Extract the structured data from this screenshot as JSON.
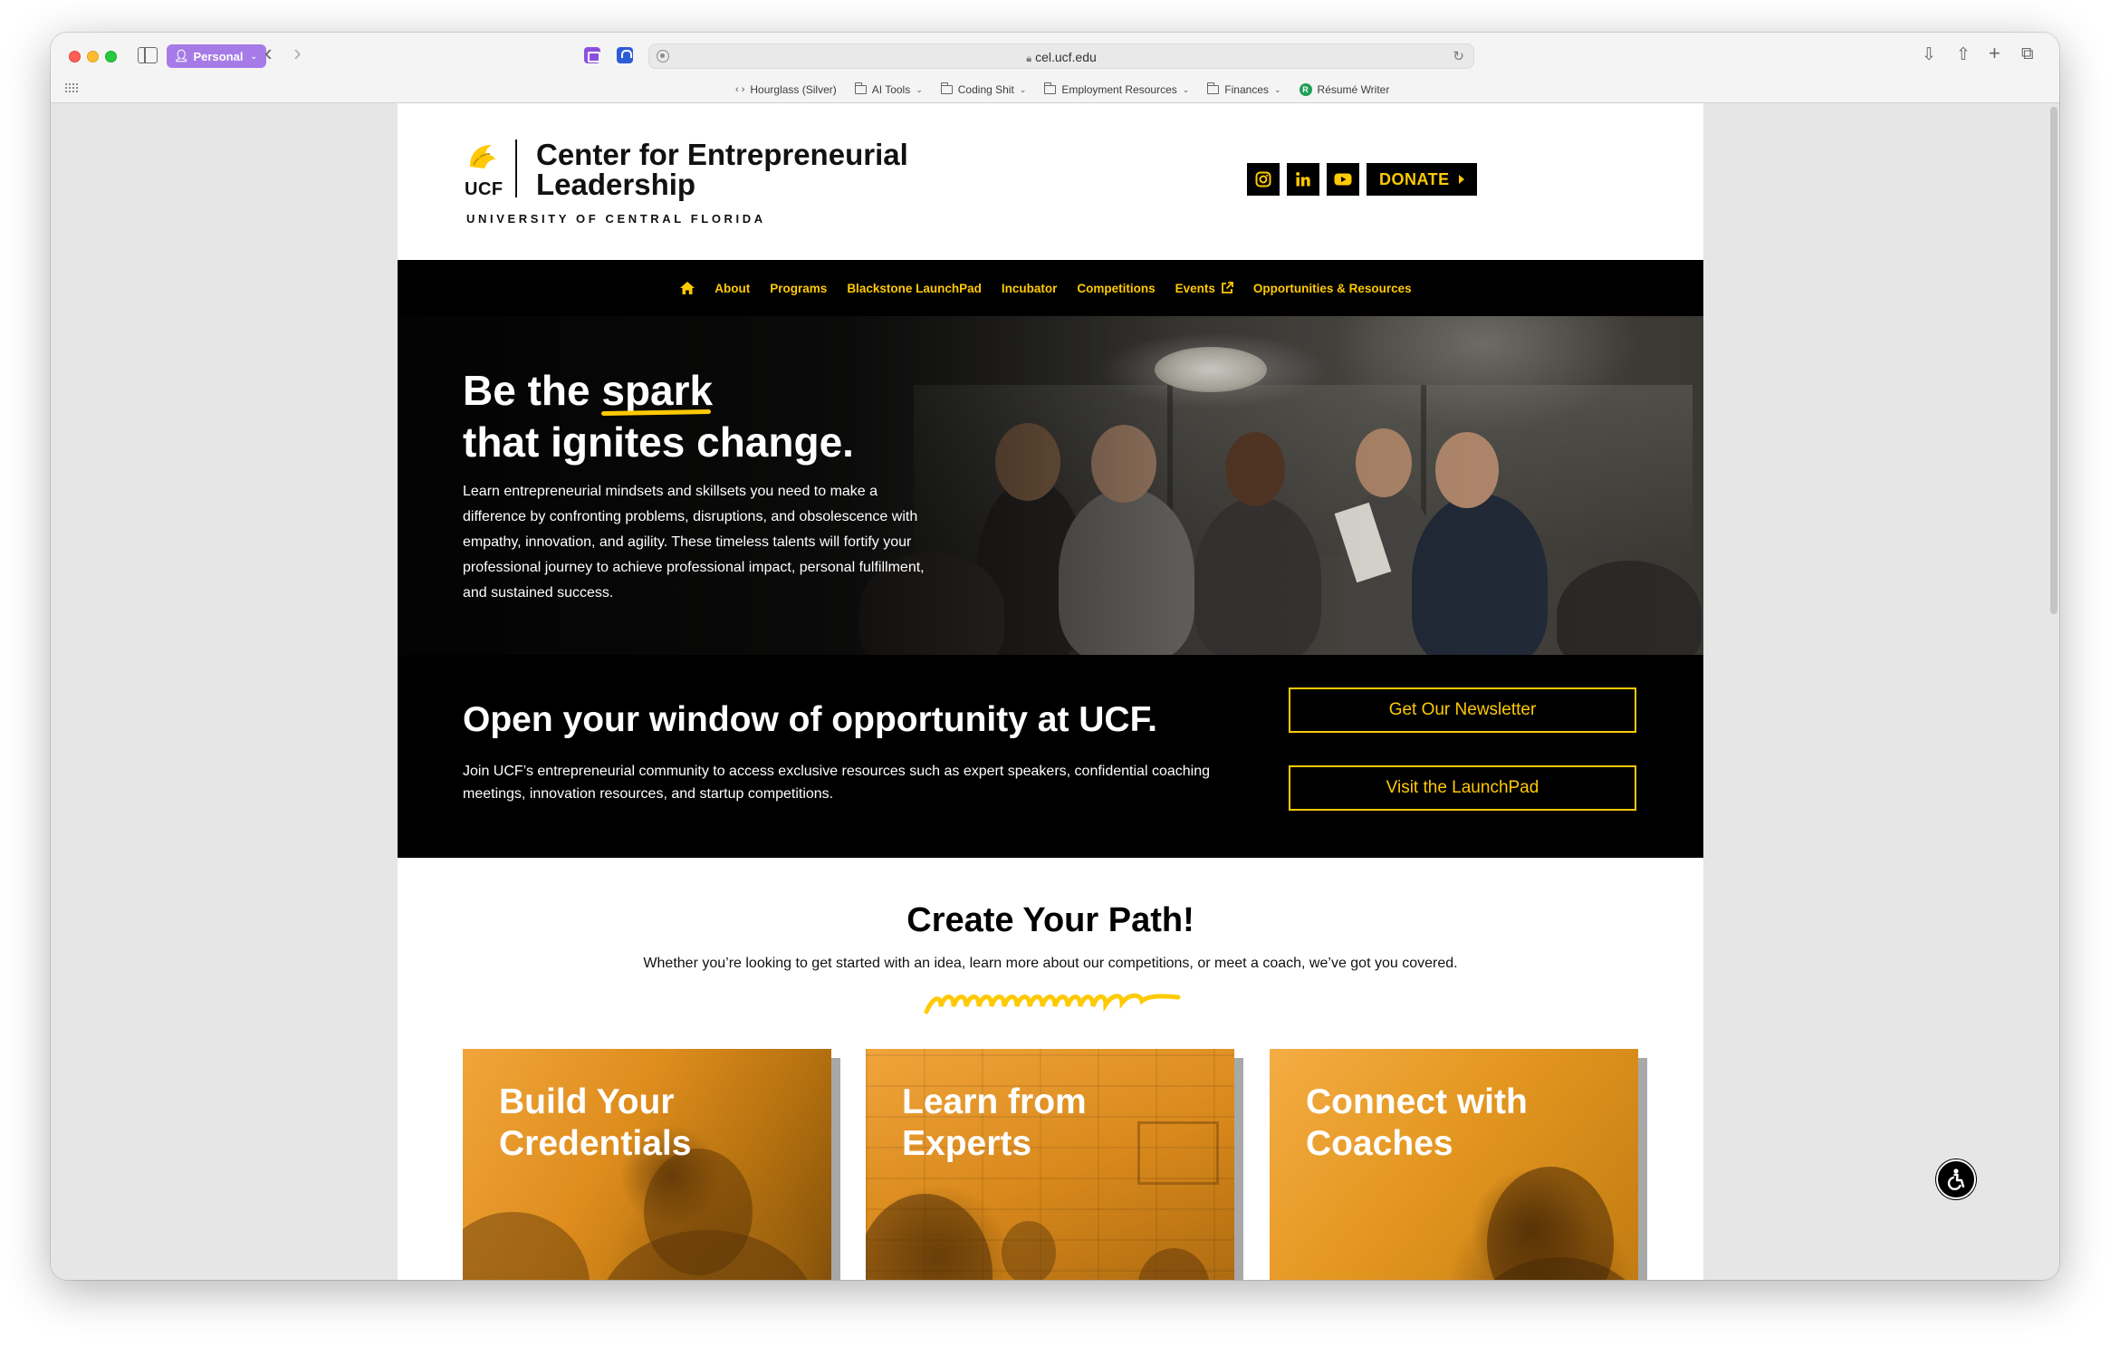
{
  "browser": {
    "profile": "Personal",
    "url": "cel.ucf.edu",
    "bookmarks": [
      {
        "label": "Hourglass (Silver)",
        "icon": "code-icon",
        "menu": false
      },
      {
        "label": "AI Tools",
        "icon": "folder-icon",
        "menu": true
      },
      {
        "label": "Coding Shit",
        "icon": "folder-icon",
        "menu": true
      },
      {
        "label": "Employment Resources",
        "icon": "folder-icon",
        "menu": true
      },
      {
        "label": "Finances",
        "icon": "folder-icon",
        "menu": true
      },
      {
        "label": "Résumé Writer",
        "icon": "resume-writer-icon",
        "menu": false
      }
    ]
  },
  "header": {
    "logo_mark": "UCF",
    "title_line1": "Center for Entrepreneurial",
    "title_line2": "Leadership",
    "subtitle": "UNIVERSITY OF CENTRAL FLORIDA",
    "donate": "DONATE",
    "social": [
      "instagram-icon",
      "linkedin-icon",
      "youtube-icon"
    ]
  },
  "nav": {
    "items": [
      "About",
      "Programs",
      "Blackstone LaunchPad",
      "Incubator",
      "Competitions",
      "Events",
      "Opportunities & Resources"
    ]
  },
  "hero": {
    "title_pre": "Be the ",
    "title_highlight": "spark",
    "title_line2": "that ignites change.",
    "body": "Learn entrepreneurial mindsets and skillsets you need to make a difference by confronting problems, disruptions, and obsolescence with empathy, innovation, and agility. These timeless talents will fortify your professional journey to achieve professional impact, personal fulfillment, and sustained success."
  },
  "cta": {
    "title": "Open your window of opportunity at UCF.",
    "body": "Join UCF’s entrepreneurial community to access exclusive resources such as expert speakers, confidential coaching meetings, innovation resources, and startup competitions.",
    "button1": "Get Our Newsletter",
    "button2": "Visit the LaunchPad"
  },
  "path": {
    "title": "Create Your Path!",
    "subtitle": "Whether you’re looking to get started with an idea, learn more about our competitions, or meet a coach, we’ve got you covered.",
    "cards": [
      {
        "line1": "Build Your",
        "line2": "Credentials"
      },
      {
        "line1": "Learn from",
        "line2": "Experts"
      },
      {
        "line1": "Connect with",
        "line2": "Coaches"
      }
    ]
  },
  "colors": {
    "accent": "#ffc904",
    "black": "#000000",
    "profile": "#a67be8"
  }
}
